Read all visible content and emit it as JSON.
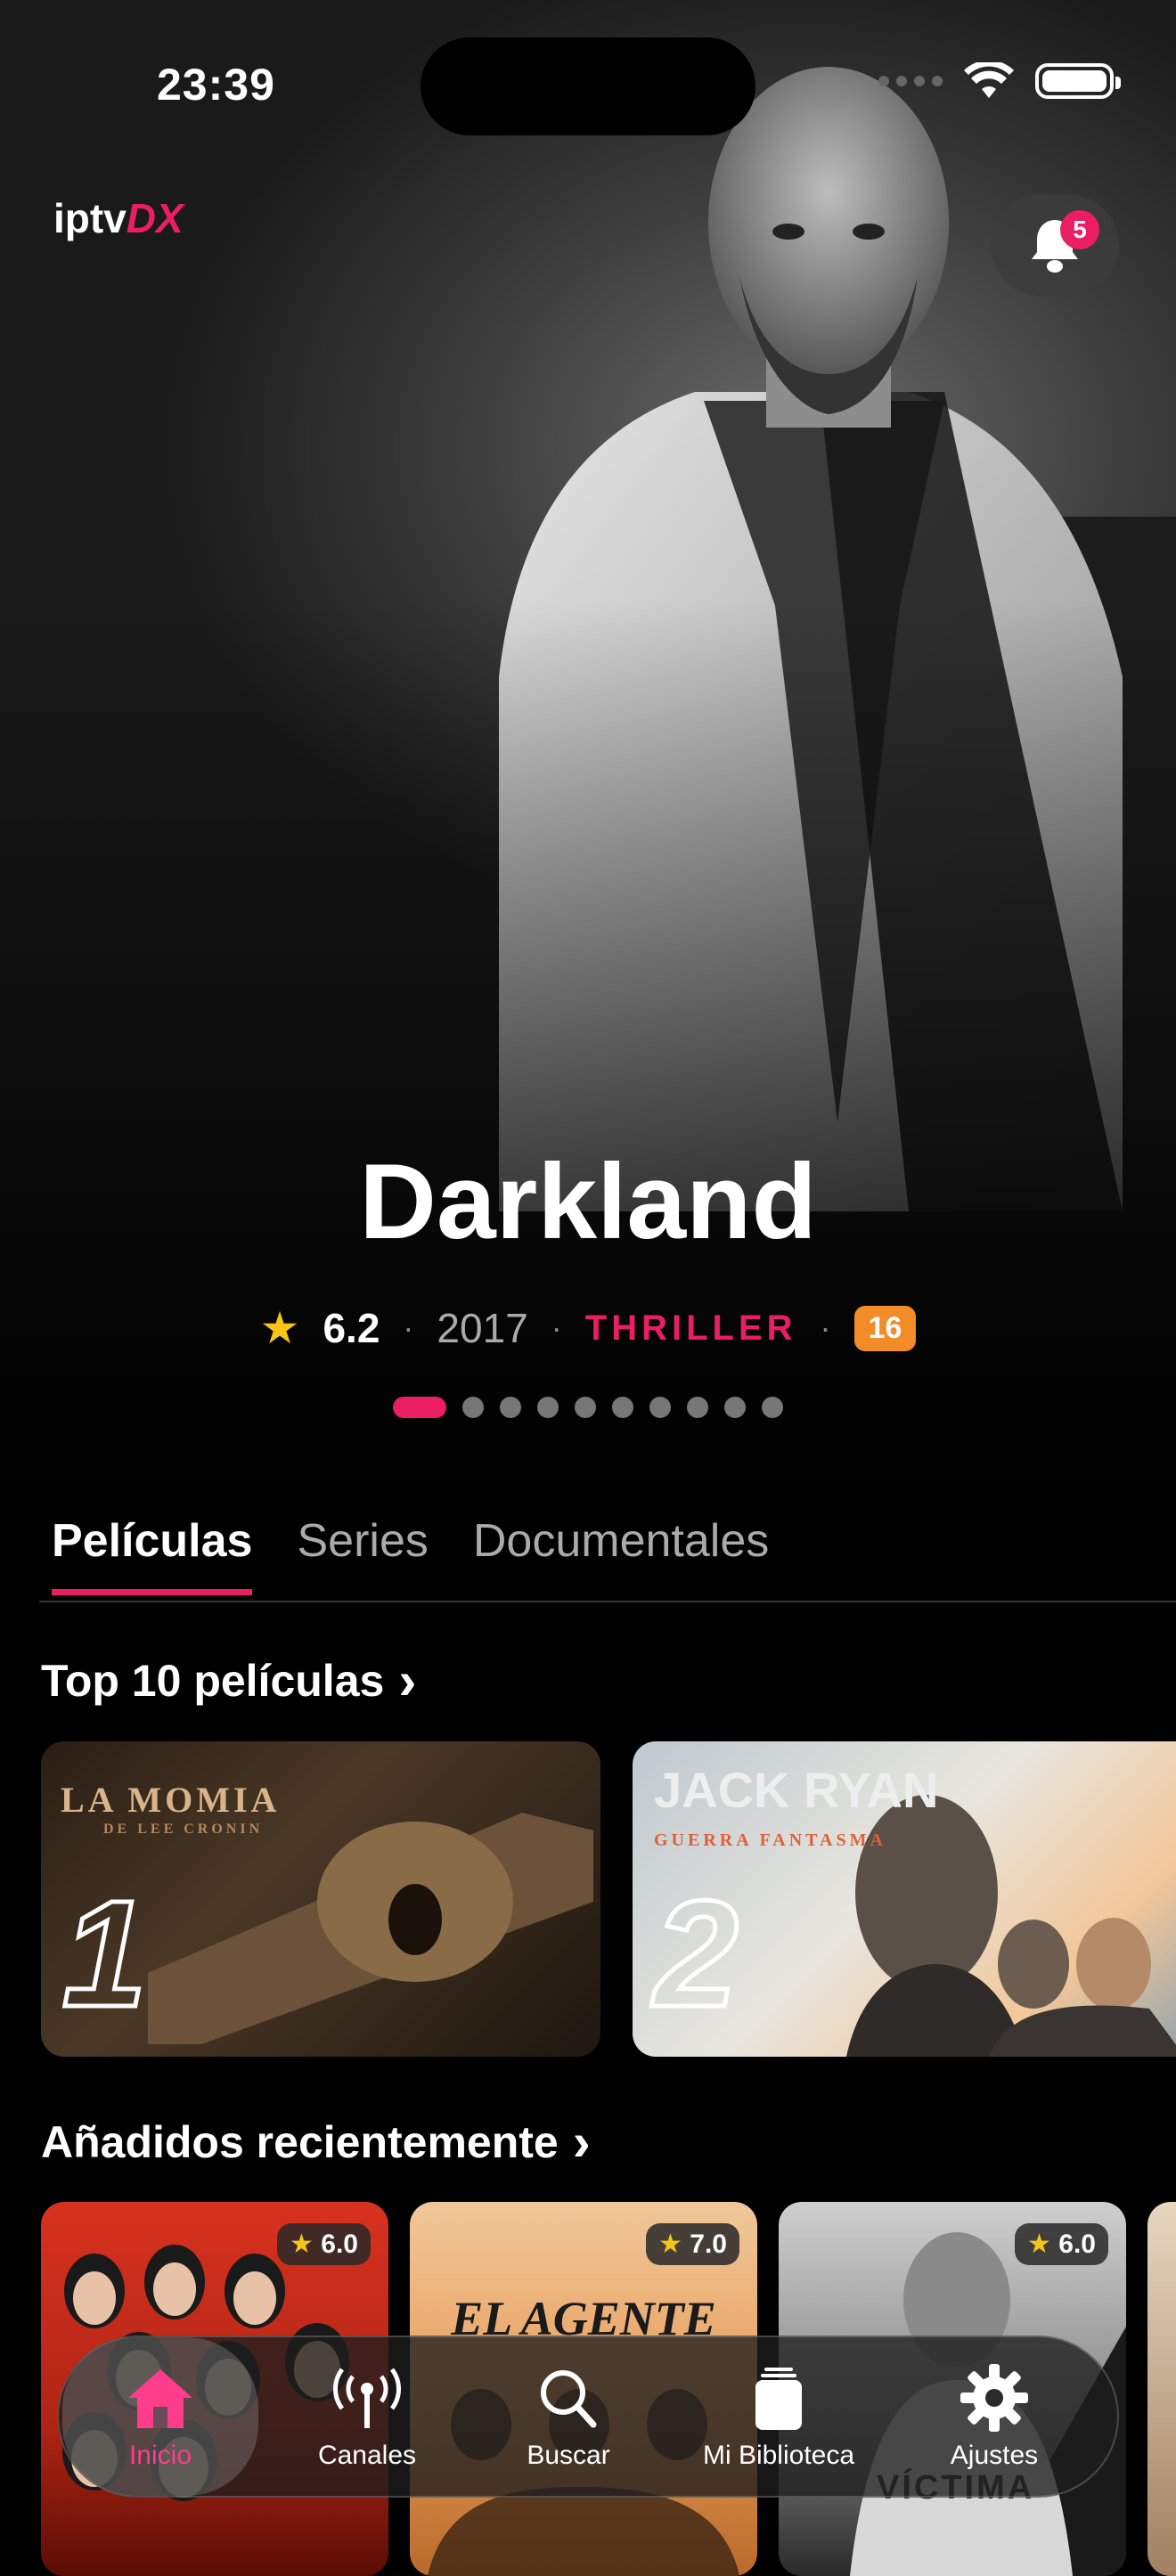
{
  "status": {
    "time": "23:39"
  },
  "header": {
    "logo_main": "iptv",
    "logo_accent": "DX",
    "notification_count": "5"
  },
  "hero": {
    "title": "Darkland",
    "rating": "6.2",
    "year": "2017",
    "genre": "THRILLER",
    "age_rating": "16",
    "pager_total": 10,
    "pager_active": 0
  },
  "tabs": [
    {
      "label": "Películas",
      "active": true
    },
    {
      "label": "Series",
      "active": false
    },
    {
      "label": "Documentales",
      "active": false
    }
  ],
  "sections": {
    "top10": {
      "title": "Top 10 películas",
      "chevron": "›"
    },
    "recent": {
      "title": "Añadidos recientemente",
      "chevron": "›"
    }
  },
  "top10_items": [
    {
      "rank": "1",
      "poster_text": "LA MOMIA",
      "poster_subtext": "DE LEE CRONIN"
    },
    {
      "rank": "2",
      "poster_text": "JACK RYAN",
      "poster_subtext": "GUERRA FANTASMA"
    }
  ],
  "recent_items": [
    {
      "rating": "6.0"
    },
    {
      "rating": "7.0",
      "poster_text": "EL AGENTE"
    },
    {
      "rating": "6.0",
      "poster_text": "VÍCTIMA"
    }
  ],
  "tabbar": {
    "items": [
      {
        "label": "Inicio",
        "icon": "home-icon",
        "active": true
      },
      {
        "label": "Canales",
        "icon": "antenna-icon",
        "active": false
      },
      {
        "label": "Buscar",
        "icon": "search-icon",
        "active": false
      },
      {
        "label": "Mi Biblioteca",
        "icon": "library-icon",
        "active": false
      },
      {
        "label": "Ajustes",
        "icon": "gear-icon",
        "active": false
      }
    ]
  },
  "colors": {
    "accent": "#e91e63",
    "star": "#f5c518",
    "age_badge": "#f28c28"
  }
}
